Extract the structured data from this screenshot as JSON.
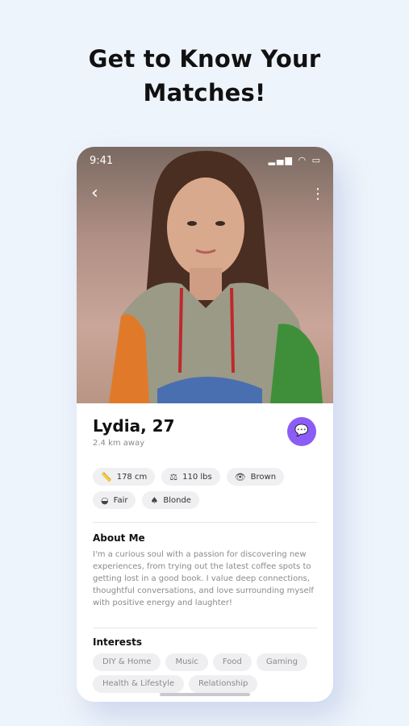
{
  "headline": {
    "line1": "Get to Know Your",
    "line2": "Matches!"
  },
  "status_bar": {
    "time": "9:41",
    "icons": [
      "signal-icon",
      "wifi-icon",
      "battery-icon"
    ]
  },
  "nav": {
    "back_icon": "chevron-left-icon",
    "more_icon": "more-vertical-icon"
  },
  "profile": {
    "name": "Lydia, 27",
    "distance": "2.4 km away",
    "chat_icon": "chat-bubble-icon",
    "attributes": [
      {
        "icon": "ruler-icon",
        "label": "178 cm"
      },
      {
        "icon": "scale-icon",
        "label": "110 lbs"
      },
      {
        "icon": "eye-icon",
        "label": "Brown"
      },
      {
        "icon": "skin-icon",
        "label": "Fair"
      },
      {
        "icon": "hair-icon",
        "label": "Blonde"
      }
    ]
  },
  "about": {
    "title": "About Me",
    "text": "I'm a curious soul with a passion for discovering new experiences, from trying out the latest coffee spots to getting lost in a good book. I value deep connections, thoughtful conversations, and love surrounding myself with positive energy and laughter!"
  },
  "interests": {
    "title": "Interests",
    "items": [
      "DIY & Home",
      "Music",
      "Food",
      "Gaming",
      "Health & Lifestyle",
      "Relationship"
    ]
  },
  "colors": {
    "accent": "#8b5cf6",
    "background": "#eef4fb",
    "chip": "#f0f0f2"
  }
}
